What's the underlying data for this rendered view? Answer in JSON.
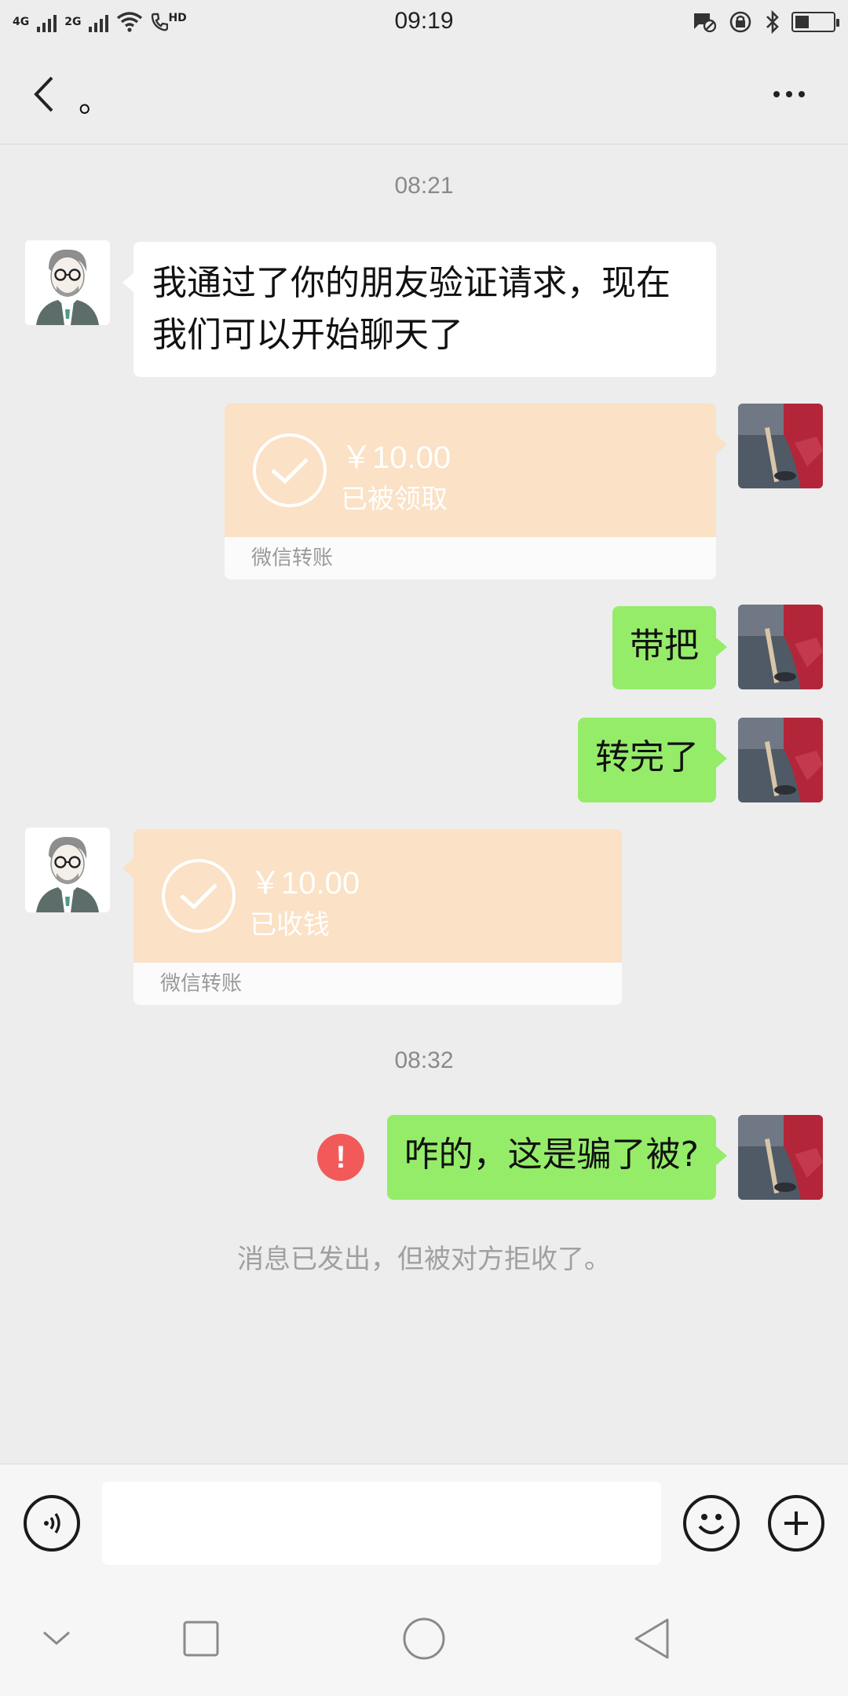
{
  "status_bar": {
    "network_1": "4G",
    "network_2": "2G",
    "call_badge": "HD",
    "time": "09:19"
  },
  "chat": {
    "title": "。",
    "timestamps": [
      "08:21",
      "08:32"
    ],
    "messages": {
      "m1": "我通过了你的朋友验证请求，现在我们可以开始聊天了",
      "t1_amount": "￥10.00",
      "t1_status": "已被领取",
      "t1_label": "微信转账",
      "m2": "带把",
      "m3": "转完了",
      "t2_amount": "￥10.00",
      "t2_status": "已收钱",
      "t2_label": "微信转账",
      "m4": "咋的，这是骗了被?",
      "error_mark": "!"
    },
    "system_notice": "消息已发出，但被对方拒收了。"
  },
  "input": {
    "value": "",
    "placeholder": ""
  },
  "colors": {
    "green_bubble": "#95ec69",
    "transfer_bg": "#fbe1c5",
    "error_red": "#f25a5a"
  }
}
